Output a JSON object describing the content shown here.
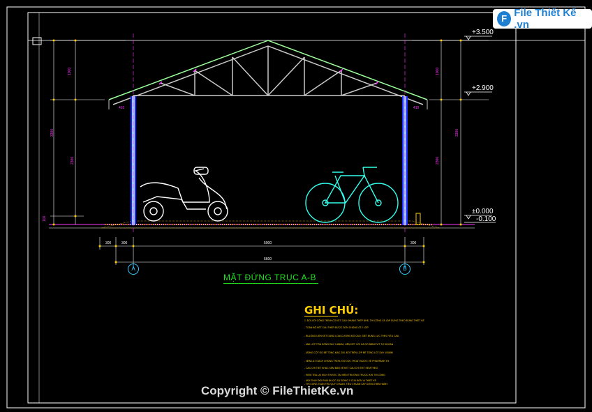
{
  "logo": {
    "brand_text": "File Thiết Kế .vn",
    "mark": "F"
  },
  "drawing": {
    "title": "MẶT ĐỨNG TRỤC A-B",
    "axes": [
      "A",
      "B"
    ],
    "elevations": [
      "+3.500",
      "+2.900",
      "±0.000",
      "-0.100"
    ],
    "dimensions_bottom": [
      "300",
      "300",
      "5000",
      "300",
      "5600"
    ],
    "dimensions_left": [
      "1000",
      "3300",
      "2300",
      "100"
    ],
    "dimensions_right": [
      "1000",
      "3300",
      "2300"
    ],
    "eave_labels": [
      "410",
      "410"
    ]
  },
  "notes": {
    "title": "GHI CHÚ:",
    "lines": [
      "1. ĐỐI VỚI CÔNG TRÌNH CÓ KẾT CẤU KHUNG THÉP NHẸ, THI CÔNG VÀ LẮP DỰNG THEO ĐÚNG THIẾT KẾ",
      "- TOÀN BỘ KẾT CẤU THÉP ĐƯỢC SƠN CHỐNG GỈ 2 LỚP",
      "- BULÔNG LIÊN KẾT DÙNG LOẠI CƯỜNG ĐỘ CAO, SIẾT ĐÚNG LỰC THEO YÊU CẦU",
      "- MÁI LỢP TÔN SÓNG DÀY 0.45MM, LIÊN KẾT VỚI XÀ GỒ BẰNG VÍT TỰ KHOAN",
      "- MÓNG CỘT ĐỔ BÊ TÔNG MÁC 200, ĐỔ TRÊN LỚP BÊ TÔNG LÓT DÀY 100MM",
      "- NỀN LÁT GẠCH CHỐNG TRƠN, ĐỘ DỐC THOÁT NƯỚC VỀ PHÍA RÃNH 1%",
      "- CÁC CHI TIẾT KHÁC XEM BẢN VẼ KẾT CẤU CHI TIẾT KÈM THEO",
      "- KIỂM TRA LẠI KÍCH THƯỚC TẠI HIỆN TRƯỜNG TRƯỚC KHI THI CÔNG",
      "- MỌI THAY ĐỔI PHẢI ĐƯỢC SỰ ĐỒNG Ý CỦA ĐƠN VỊ THIẾT KẾ",
      "- THI CÔNG TUÂN THỦ QUY CHUẨN, TIÊU CHUẨN XÂY DỰNG HIỆN HÀNH"
    ]
  },
  "copyright": "Copyright © FileThietKe.vn",
  "colors": {
    "background": "#000000",
    "frame": "#ffffff",
    "structure_blue": "#4a7dff",
    "magenta": "#ff33ff",
    "yellow": "#ffcc00",
    "green": "#20e020",
    "cyan": "#33ccff"
  }
}
